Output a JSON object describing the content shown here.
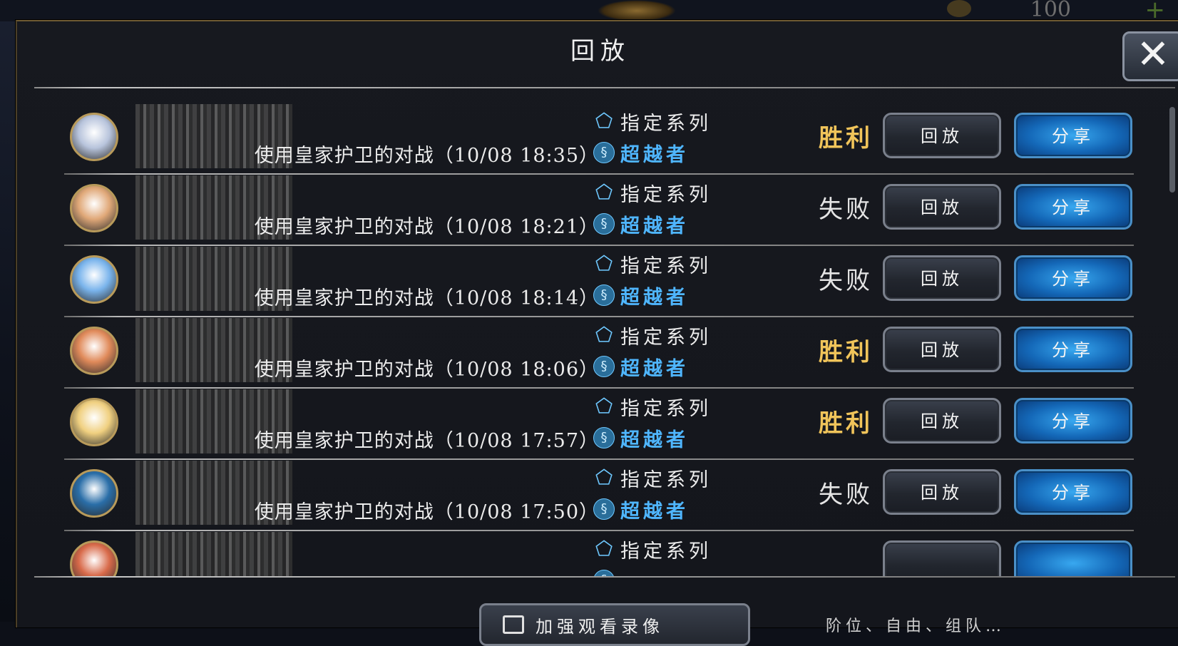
{
  "background": {
    "currency_value": "100"
  },
  "dialog": {
    "title": "回放",
    "close_icon": "close-icon"
  },
  "colors": {
    "win": "#f0c45a",
    "lose": "#e4e4e4",
    "class_tag": "#4fb6ff",
    "share_button": "#1e7fd0",
    "replay_button": "#2a2f38"
  },
  "replays": [
    {
      "avatar_color": "#b8c4dc",
      "match": "使用皇家护卫的对战（10/08 18:35）",
      "series": "指定系列",
      "class": "超越者",
      "result": "胜利",
      "outcome": "win",
      "replay_label": "回放",
      "share_label": "分享"
    },
    {
      "avatar_color": "#e0a878",
      "match": "使用皇家护卫的对战（10/08 18:21）",
      "series": "指定系列",
      "class": "超越者",
      "result": "失败",
      "outcome": "lose",
      "replay_label": "回放",
      "share_label": "分享"
    },
    {
      "avatar_color": "#7ab4ec",
      "match": "使用皇家护卫的对战（10/08 18:14）",
      "series": "指定系列",
      "class": "超越者",
      "result": "失败",
      "outcome": "lose",
      "replay_label": "回放",
      "share_label": "分享"
    },
    {
      "avatar_color": "#e08a5a",
      "match": "使用皇家护卫的对战（10/08 18:06）",
      "series": "指定系列",
      "class": "超越者",
      "result": "胜利",
      "outcome": "win",
      "replay_label": "回放",
      "share_label": "分享"
    },
    {
      "avatar_color": "#f0d080",
      "match": "使用皇家护卫的对战（10/08 17:57）",
      "series": "指定系列",
      "class": "超越者",
      "result": "胜利",
      "outcome": "win",
      "replay_label": "回放",
      "share_label": "分享"
    },
    {
      "avatar_color": "#2a6ea8",
      "match": "使用皇家护卫的对战（10/08 17:50）",
      "series": "指定系列",
      "class": "超越者",
      "result": "失败",
      "outcome": "lose",
      "replay_label": "回放",
      "share_label": "分享"
    },
    {
      "avatar_color": "#d86a4a",
      "match": "",
      "series": "指定系列",
      "class": "",
      "result": "",
      "outcome": "lose",
      "replay_label": "",
      "share_label": ""
    }
  ],
  "footer": {
    "button_label": "加强观看录像",
    "note": "阶位、自由、组队…"
  }
}
